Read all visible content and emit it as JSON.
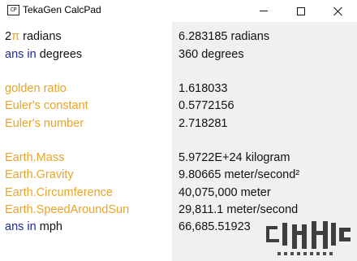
{
  "window": {
    "title": "TekaGen CalcPad",
    "icon_text": "CP",
    "icon_name": "app-icon"
  },
  "colors": {
    "constant": "#e8a427",
    "keyword": "#1d2a9c",
    "text": "#111111",
    "result_background": "#f0f0f0"
  },
  "inputs": [
    {
      "part1": "2",
      "part2": "π",
      "part3": " radians"
    },
    {
      "part1": "ans",
      "part2": " in ",
      "part3": "degrees"
    },
    {
      "part1": "golden ratio"
    },
    {
      "part1": "Euler's constant"
    },
    {
      "part1": "Euler's number"
    },
    {
      "part1": "Earth.Mass"
    },
    {
      "part1": "Earth.Gravity"
    },
    {
      "part1": "Earth.Circumference"
    },
    {
      "part1": "Earth.SpeedAroundSun"
    },
    {
      "part1": "ans",
      "part2": " in ",
      "part3": "mph"
    }
  ],
  "results": [
    "6.283185 radians",
    "360 degrees",
    "1.618033",
    "0.5772156",
    "2.718281",
    "5.9722E+24 kilogram",
    "9.80665 meter/second²",
    "40,075,000 meter",
    "29,811.1 meter/second",
    "66,685.51923"
  ]
}
